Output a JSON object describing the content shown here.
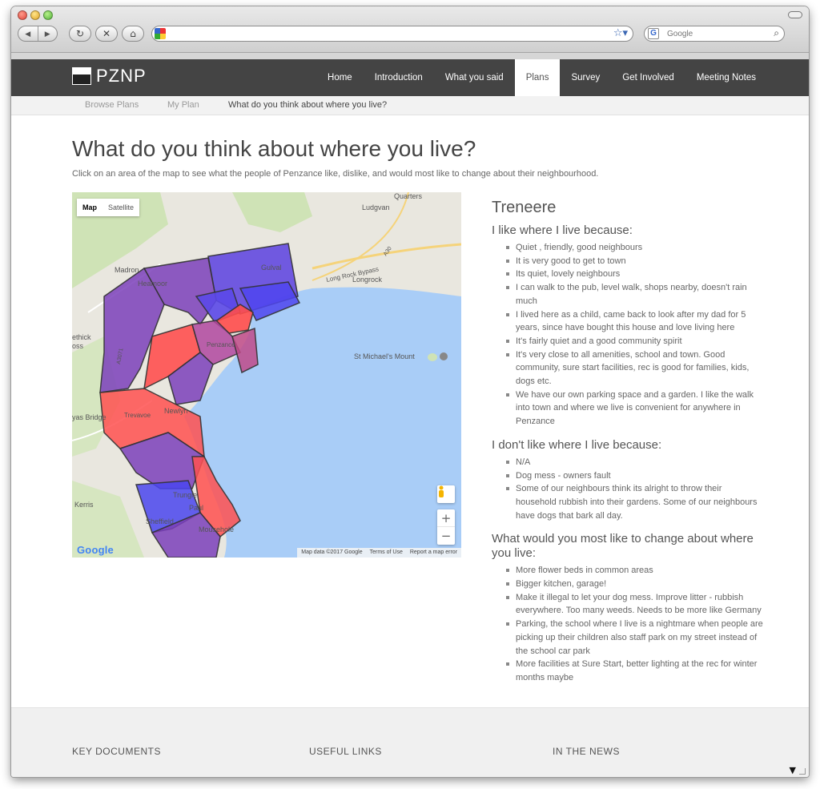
{
  "browser": {
    "search_placeholder": "Google",
    "icons": [
      "back-icon",
      "forward-icon",
      "reload-icon",
      "stop-icon",
      "home-icon",
      "bookmark-star-icon",
      "search-icon"
    ]
  },
  "site": {
    "logo_text": "PZNP",
    "nav": [
      {
        "label": "Home",
        "active": false
      },
      {
        "label": "Introduction",
        "active": false
      },
      {
        "label": "What you said",
        "active": false
      },
      {
        "label": "Plans",
        "active": true
      },
      {
        "label": "Survey",
        "active": false
      },
      {
        "label": "Get Involved",
        "active": false
      },
      {
        "label": "Meeting Notes",
        "active": false
      }
    ],
    "subnav": [
      "Browse Plans",
      "My Plan",
      "What do you think about where you live?"
    ]
  },
  "page": {
    "title": "What do you think about where you live?",
    "intro": "Click on an area of the map to see what the people of Penzance like, dislike, and would most like to change about their neighbourhood."
  },
  "map": {
    "type_map": "Map",
    "type_satellite": "Satellite",
    "logo": "Google",
    "attribution": "Map data ©2017 Google",
    "terms": "Terms of Use",
    "report": "Report a map error",
    "labels": [
      "Quarters",
      "Ludgvan",
      "Madron",
      "Heamoor",
      "Gulval",
      "Long Rock Bypass",
      "Longrock",
      "ethick",
      "oss",
      "St Michael's Mount",
      "Penzance",
      "Newlyn",
      "yas Bridge",
      "Trevavoe",
      "Kerris",
      "Sheffield",
      "Paul",
      "Trungle",
      "Mousehole",
      "A30",
      "A3071"
    ],
    "colors": {
      "sea": "#a9cdf7",
      "land": "#e9e7df",
      "green": "#cfe3b6",
      "red_zone": "#ff4d4d",
      "purple_zone": "#7a44c8",
      "blue_zone": "#5a4be8"
    }
  },
  "panel": {
    "area": "Treneere",
    "like_heading": "I like where I live because:",
    "like": [
      "Quiet , friendly, good neighbours",
      "It is very good to get to town",
      "Its quiet, lovely neighbours",
      "I can walk to the pub, level walk, shops nearby, doesn't rain much",
      "I lived here as a child, came back to look after my dad for 5 years, since have bought this house and love living here",
      "It's fairly quiet and a good community spirit",
      "It's very close to all amenities, school and town. Good community, sure start facilities, rec is good for families, kids, dogs etc.",
      "We have our own parking space and a garden. I like the walk into town and where we live is convenient for anywhere in Penzance"
    ],
    "dislike_heading": "I don't like where I live because:",
    "dislike": [
      "N/A",
      "Dog mess - owners fault",
      "Some of our neighbours think its alright to throw their household rubbish into their gardens. Some of our neighbours have dogs that bark all day."
    ],
    "change_heading": "What would you most like to change about where you live:",
    "change": [
      "More flower beds in common areas",
      "Bigger kitchen, garage!",
      "Make it illegal to let your dog mess. Improve litter - rubbish everywhere. Too many weeds. Needs to be more like Germany",
      "Parking, the school where I live is a nightmare when people are picking up their children also staff park on my street instead of the school car park",
      "More facilities at Sure Start, better lighting at the rec for winter months maybe"
    ]
  },
  "footer": {
    "col1": "KEY DOCUMENTS",
    "col2": "USEFUL LINKS",
    "col3": "IN THE NEWS"
  }
}
